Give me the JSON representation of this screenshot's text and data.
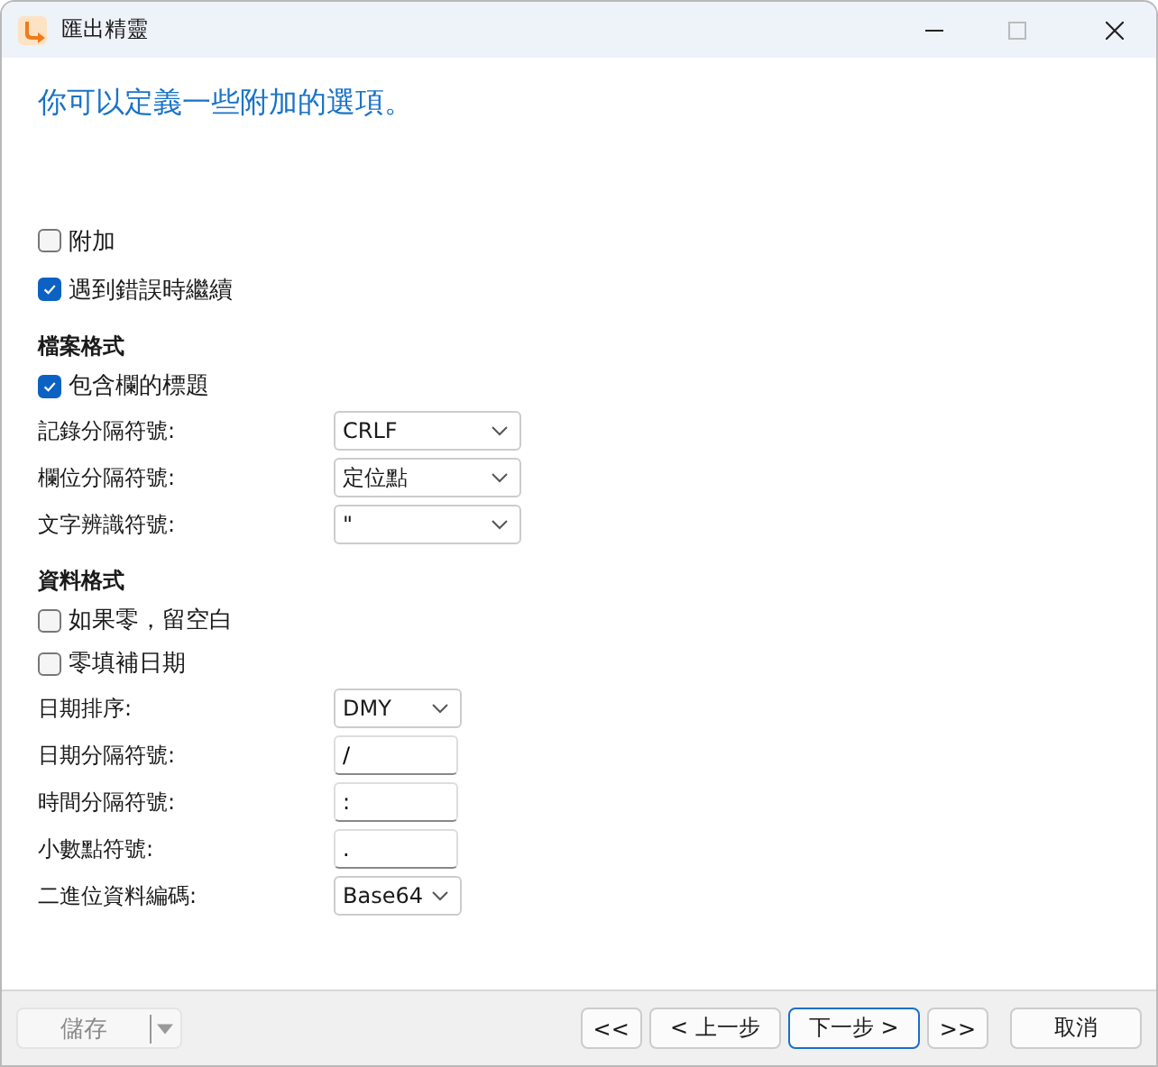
{
  "window": {
    "title": "匯出精靈"
  },
  "heading": "你可以定義一些附加的選項。",
  "options": [
    {
      "label": "附加",
      "checked": false
    },
    {
      "label": "遇到錯誤時繼續",
      "checked": true
    }
  ],
  "sections": [
    {
      "title": "檔案格式",
      "items": [
        {
          "kind": "checkbox",
          "label": "包含欄的標題",
          "checked": true
        },
        {
          "kind": "select",
          "label": "記錄分隔符號:",
          "value": "CRLF"
        },
        {
          "kind": "select",
          "label": "欄位分隔符號:",
          "value": "定位點"
        },
        {
          "kind": "select",
          "label": "文字辨識符號:",
          "value": "\""
        }
      ]
    },
    {
      "title": "資料格式",
      "items": [
        {
          "kind": "checkbox",
          "label": "如果零，留空白",
          "checked": false
        },
        {
          "kind": "checkbox",
          "label": "零填補日期",
          "checked": false
        },
        {
          "kind": "select",
          "label": "日期排序:",
          "value": "DMY"
        },
        {
          "kind": "text",
          "label": "日期分隔符號:",
          "value": "/"
        },
        {
          "kind": "text",
          "label": "時間分隔符號:",
          "value": ":"
        },
        {
          "kind": "text",
          "label": "小數點符號:",
          "value": "."
        },
        {
          "kind": "select",
          "label": "二進位資料編碼:",
          "value": "Base64"
        }
      ]
    }
  ],
  "footer": {
    "save": {
      "label": "儲存",
      "disabled": true
    },
    "nav": [
      {
        "label": "<<",
        "focused": false
      },
      {
        "label": "< 上一步",
        "focused": false
      },
      {
        "label": "下一步 >",
        "focused": true
      },
      {
        "label": ">>",
        "focused": false
      }
    ],
    "cancel": "取消"
  }
}
